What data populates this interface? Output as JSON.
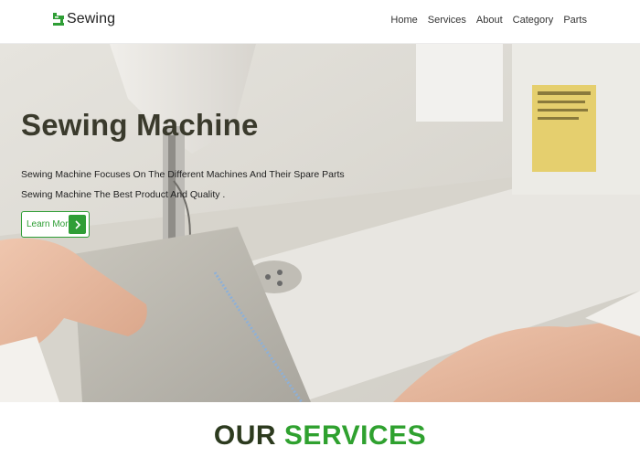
{
  "brand": {
    "name": "Sewing",
    "icon": "sewing-machine-icon",
    "color": "#2f9e36"
  },
  "nav": {
    "links": [
      {
        "label": "Home"
      },
      {
        "label": "Services"
      },
      {
        "label": "About"
      },
      {
        "label": "Category"
      },
      {
        "label": "Parts"
      }
    ]
  },
  "hero": {
    "title": "Sewing Machine",
    "line1": "Sewing Machine Focuses On The Different Machines And Their Spare Parts",
    "line2": "Sewing Machine The Best Product And Quality .",
    "cta_label": "Learn More",
    "cta_icon": "chevron-right-icon"
  },
  "services": {
    "title_part1": "OUR",
    "title_part2": "SERVICES"
  },
  "colors": {
    "accent": "#2f9e36",
    "heading_dark": "#2c3a1e"
  }
}
